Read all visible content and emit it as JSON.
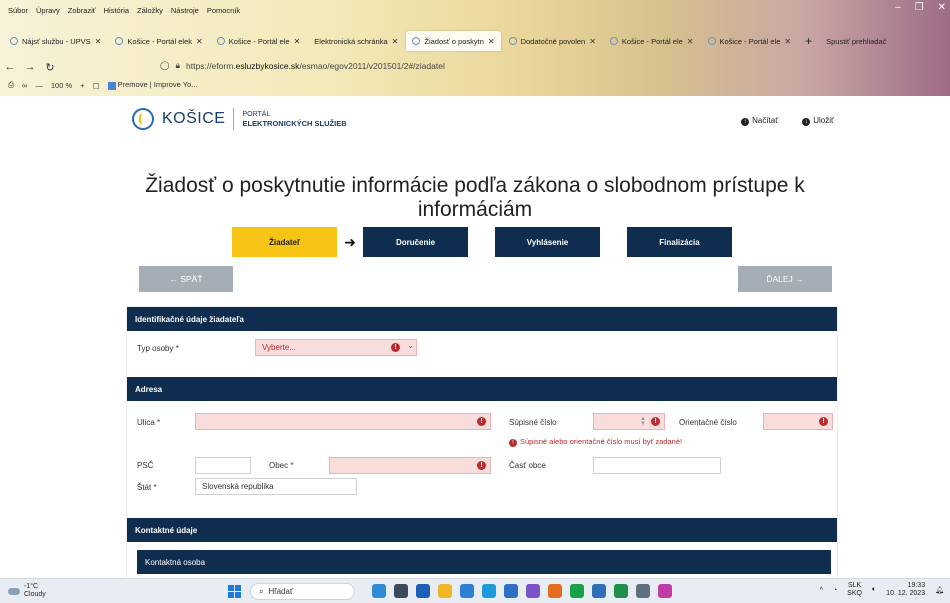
{
  "browser": {
    "menu": [
      "Súbor",
      "Úpravy",
      "Zobraziť",
      "História",
      "Záložky",
      "Nástroje",
      "Pomocník"
    ],
    "tabs": [
      {
        "label": "Nájsť službu - UPVS",
        "active": false
      },
      {
        "label": "Košice - Portál elek",
        "active": false
      },
      {
        "label": "Košice - Portál ele",
        "active": false
      },
      {
        "label": "Elektronická schránka",
        "active": false
      },
      {
        "label": "Žiadosť o poskytn",
        "active": true
      },
      {
        "label": "Dodatočné povolen",
        "active": false
      },
      {
        "label": "Košice - Portál ele",
        "active": false
      },
      {
        "label": "Košice - Portál ele",
        "active": false
      }
    ],
    "new_tab": "+",
    "url_prefix": "https://eform.",
    "url_domain": "esluzbykosice.sk",
    "url_path": "/esmao/egov2011/v201501/2#/ziadatel",
    "zoom": "100 %",
    "bookmarks": [
      "Premove | Improve Yo..."
    ],
    "side_tab_label": "Spustiť prehliadač"
  },
  "header": {
    "city": "KOŠICE",
    "portal_line1": "PORTÁL",
    "portal_line2": "ELEKTRONICKÝCH SLUŽIEB",
    "load_label": "Načítať",
    "save_label": "Uložiť"
  },
  "page_title": "Žiadosť o poskytnutie informácie podľa zákona o slobodnom prístupe k informáciám",
  "steps": [
    {
      "label": "Žiadateľ",
      "active": true
    },
    {
      "label": "Doručenie",
      "active": false
    },
    {
      "label": "Vyhlásenie",
      "active": false
    },
    {
      "label": "Finalizácia",
      "active": false
    }
  ],
  "nav": {
    "back": "← SPÄŤ",
    "next": "ĎALEJ →"
  },
  "sections": {
    "identity": {
      "title": "Identifikačné údaje žiadateľa",
      "person_type_label": "Typ osoby *",
      "person_type_value": "Vyberte..."
    },
    "address": {
      "title": "Adresa",
      "street_label": "Ulica *",
      "street_value": "",
      "sup_number_label": "Súpisné číslo",
      "sup_number_value": "",
      "orient_number_label": "Orientačné číslo",
      "orient_number_value": "",
      "error_message": "Súpisné alebo orientačné číslo musí byť zadané!",
      "psc_label": "PSČ",
      "psc_value": "",
      "city_label": "Obec *",
      "city_value": "",
      "city_part_label": "Časť obce",
      "city_part_value": "",
      "state_label": "Štát *",
      "state_value": "Slovenská republika"
    },
    "contact": {
      "title": "Kontaktné údaje",
      "sub_title": "Kontaktná osoba"
    }
  },
  "taskbar": {
    "weather_temp": "-1°C",
    "weather_text": "Cloudy",
    "search_placeholder": "Hľadať",
    "lang_line1": "SLK",
    "lang_line2": "SKQ",
    "time": "19:33",
    "date": "10. 12. 2023"
  },
  "colors": {
    "navy": "#0f2d4e",
    "accent_yellow": "#f8c516",
    "error_red": "#b92c2c",
    "error_bg": "#f9dcdc",
    "nav_grey": "#a5aeb6"
  }
}
